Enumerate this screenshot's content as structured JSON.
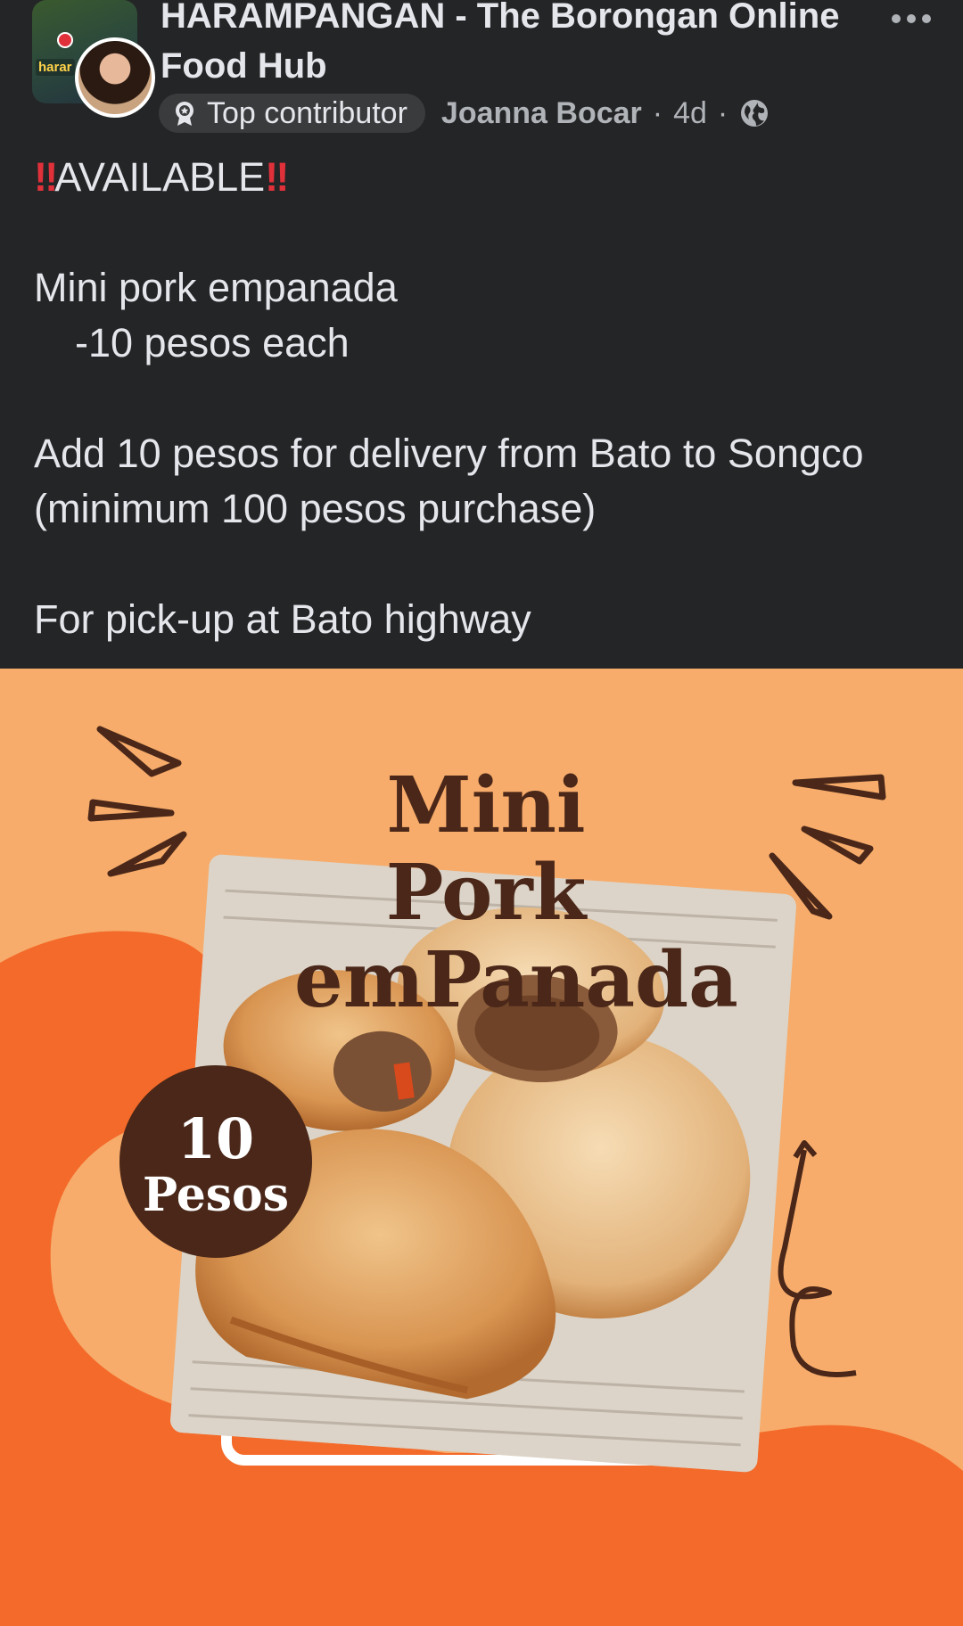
{
  "group": {
    "name": "HARAMPANGAN - The Borongan Online Food Hub",
    "avatar_label": "harar"
  },
  "post": {
    "badge_label": "Top contributor",
    "author": "Joanna Bocar",
    "separator": "·",
    "time": "4d",
    "alarm_icon": "‼",
    "available_label": "AVAILABLE",
    "lines": {
      "item_name": "Mini pork empanada",
      "item_price": "-10 pesos each",
      "delivery": "Add 10 pesos for delivery from Bato to Songco",
      "minimum": "(minimum 100 pesos purchase)",
      "pickup": "For pick-up at Bato highway"
    }
  },
  "promo": {
    "title_line1": "Mini Pork",
    "title_line2": "emPanada",
    "price_number": "10",
    "price_unit": "Pesos"
  },
  "icons": {
    "more": "more-options-icon",
    "badge": "top-contributor-badge-icon",
    "privacy": "globe-icon"
  },
  "colors": {
    "background": "#242526",
    "text": "#e4e6eb",
    "secondary_text": "#b0b3b8",
    "badge_bg": "#3a3b3c",
    "alarm": "#e0313b",
    "promo_peach": "#f7ac6b",
    "promo_orange": "#f46a2a",
    "promo_brown": "#4a2718"
  }
}
